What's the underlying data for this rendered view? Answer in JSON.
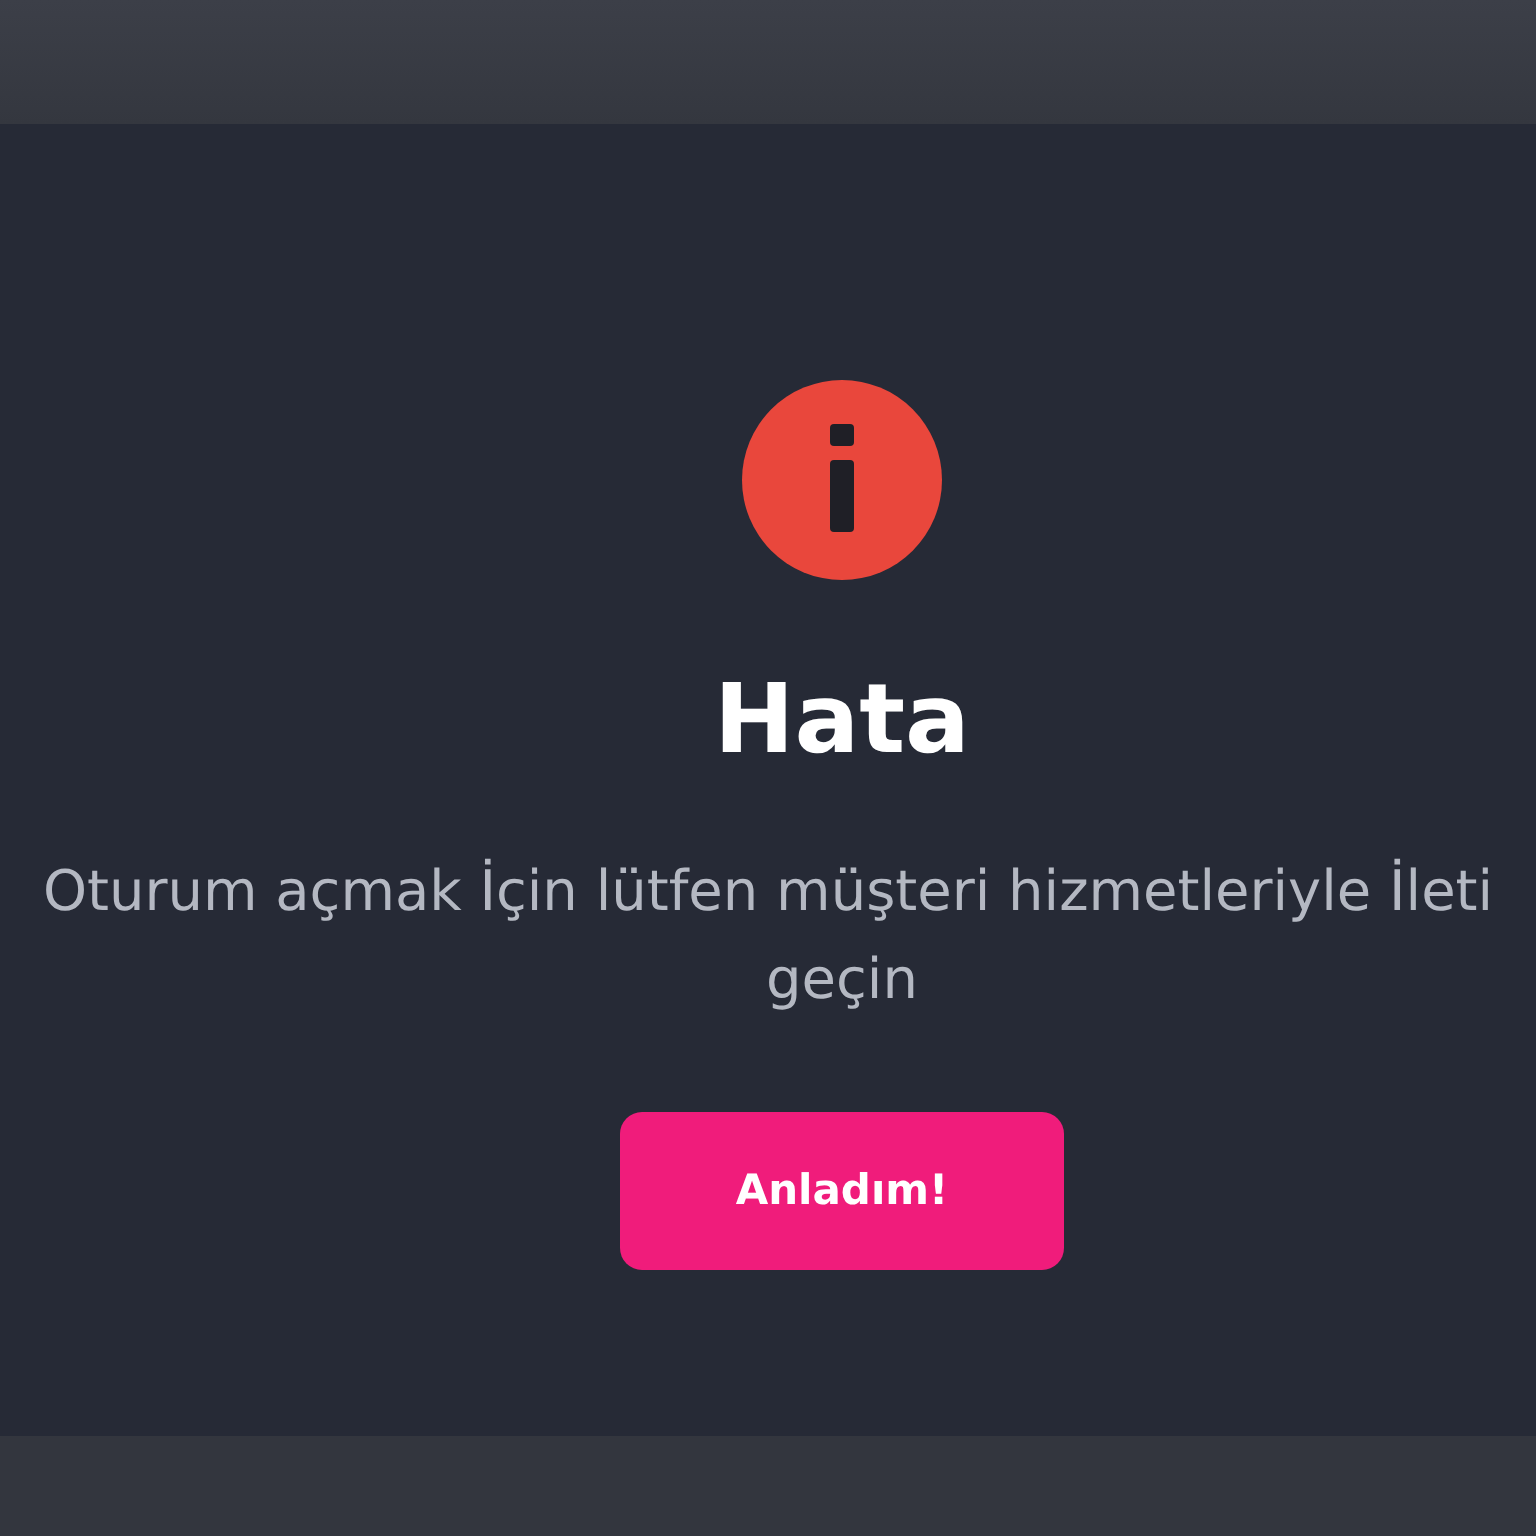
{
  "dialog": {
    "title": "Hata",
    "message_lines": [
      "Oturum açmak İçin lütfen müşteri hizmetleriyle İleti",
      "geçin"
    ],
    "button": "Anladım!"
  }
}
